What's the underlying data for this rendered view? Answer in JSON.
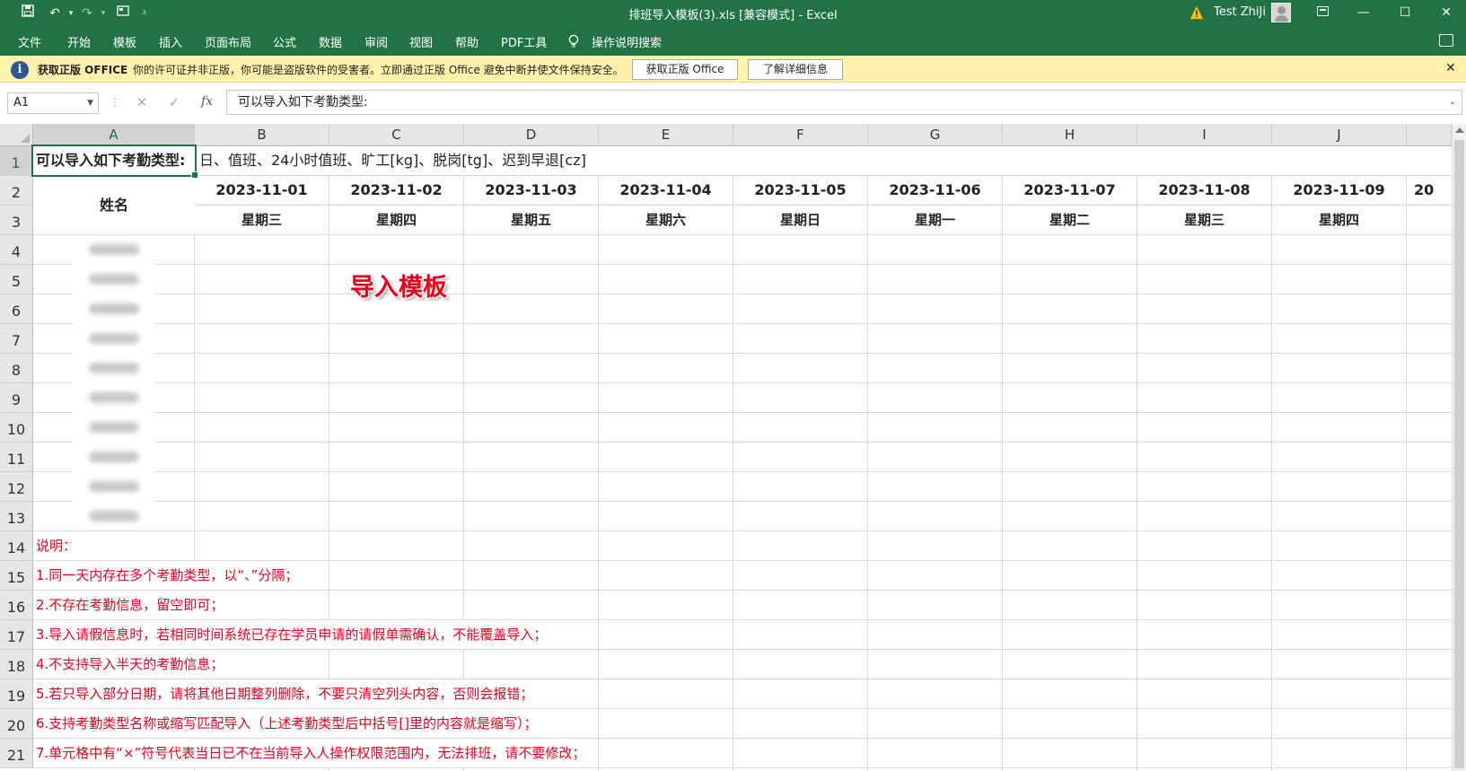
{
  "window": {
    "title": "排班导入模板(3).xls  [兼容模式]  -  Excel",
    "user": "Test ZhiJi",
    "colors": {
      "excel_green": "#217346",
      "message_bar": "#fff2ab",
      "note_red": "#e8001c"
    }
  },
  "quick_access": {
    "save_icon": "save-icon",
    "undo_icon": "undo-icon",
    "redo_icon": "redo-icon",
    "customize_icon": "customize-icon"
  },
  "menu": {
    "items": [
      "文件",
      "开始",
      "模板",
      "插入",
      "页面布局",
      "公式",
      "数据",
      "审阅",
      "视图",
      "帮助",
      "PDF工具",
      "操作说明搜索"
    ]
  },
  "message_bar": {
    "title": "获取正版 OFFICE",
    "text": "你的许可证并非正版，你可能是盗版软件的受害者。立即通过正版 Office 避免中断并使文件保持安全。",
    "button1": "获取正版 Office",
    "button2": "了解详细信息"
  },
  "formula_bar": {
    "name_box": "A1",
    "content": "可以导入如下考勤类型:",
    "fx": "fx"
  },
  "sheet": {
    "columns": [
      "A",
      "B",
      "C",
      "D",
      "E",
      "F",
      "G",
      "H",
      "I",
      "J"
    ],
    "rows": [
      "1",
      "2",
      "3",
      "4",
      "5",
      "6",
      "7",
      "8",
      "9",
      "10",
      "11",
      "12",
      "13",
      "14",
      "15",
      "16",
      "17",
      "18",
      "19",
      "20",
      "21"
    ],
    "a1": "可以导入如下考勤类型:",
    "row1_rest": "日、值班、24小时值班、旷工[kg]、脱岗[tg]、迟到早退[cz]",
    "name_header": "姓名",
    "dates": [
      "2023-11-01",
      "2023-11-02",
      "2023-11-03",
      "2023-11-04",
      "2023-11-05",
      "2023-11-06",
      "2023-11-07",
      "2023-11-08",
      "2023-11-09"
    ],
    "overflow_date": "20",
    "weekdays": [
      "星期三",
      "星期四",
      "星期五",
      "星期六",
      "星期日",
      "星期一",
      "星期二",
      "星期三",
      "星期四"
    ],
    "watermark": "导入模板",
    "notes": [
      "说明：",
      "1.同一天内存在多个考勤类型，以“、”分隔；",
      "2.不存在考勤信息，留空即可；",
      "3.导入请假信息时，若相同时间系统已存在学员申请的请假单需确认，不能覆盖导入；",
      "4.不支持导入半天的考勤信息；",
      "5.若只导入部分日期，请将其他日期整列删除，不要只清空列头内容，否则会报错；",
      "6.支持考勤类型名称或缩写匹配导入（上述考勤类型后中括号[]里的内容就是缩写）；",
      "7.单元格中有“×”符号代表当日已不在当前导入人操作权限范围内，无法排班，请不要修改；"
    ]
  }
}
